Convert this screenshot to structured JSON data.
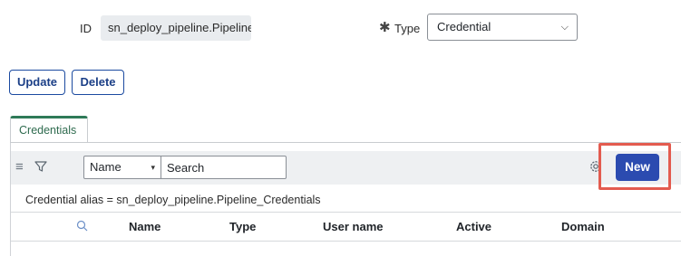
{
  "form": {
    "id_label": "ID",
    "id_value": "sn_deploy_pipeline.Pipeline",
    "type_required_marker": "✱",
    "type_label": "Type",
    "type_value": "Credential"
  },
  "actions": {
    "update_label": "Update",
    "delete_label": "Delete"
  },
  "tabs": [
    {
      "label": "Credentials"
    }
  ],
  "related_list": {
    "field_select_value": "Name",
    "search_placeholder": "Search",
    "new_label": "New",
    "filter_breadcrumb": "Credential alias = sn_deploy_pipeline.Pipeline_Credentials",
    "columns": [
      "Name",
      "Type",
      "User name",
      "Active",
      "Domain"
    ]
  },
  "icons": {
    "menu": "hamburger-icon",
    "filter": "funnel-icon",
    "settings": "gear-icon",
    "column_search": "search-icon"
  },
  "colors": {
    "primary_button": "#2b4bb0",
    "highlight_box": "#e35b4f",
    "tab_accent": "#2f7a58"
  }
}
